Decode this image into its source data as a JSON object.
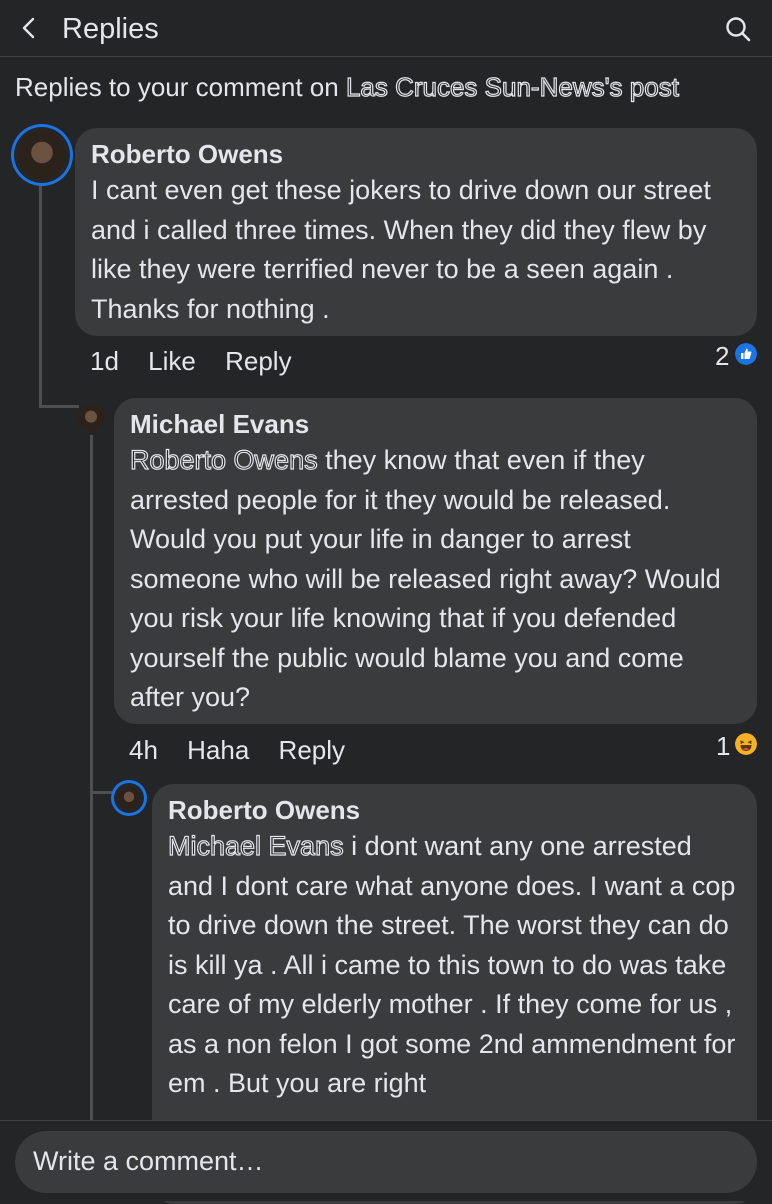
{
  "header": {
    "title": "Replies",
    "back_icon": "chevron-left-icon",
    "search_icon": "search-icon"
  },
  "context": {
    "prefix": "Replies to your comment on ",
    "page_name": "Las Cruces Sun-News",
    "suffix": "'s post"
  },
  "comments": [
    {
      "author": "Roberto Owens",
      "text": "I cant even get these jokers to drive down our street and i called three times. When they did they flew by like they were terrified never to be a seen again . Thanks for nothing .",
      "time": "1d",
      "actions": [
        "Like",
        "Reply"
      ],
      "reaction_count": "2",
      "reaction": "like-icon"
    },
    {
      "author": "Michael Evans",
      "mention": "Roberto Owens",
      "text": " they know that even if they arrested people for it they would be released.  Would you put your life in danger to arrest someone who will be released right away?  Would you risk your life knowing that if you defended yourself the public would blame you and come after you?",
      "time": "4h",
      "actions": [
        "Haha",
        "Reply"
      ],
      "reaction_count": "1",
      "reaction": "haha-icon"
    },
    {
      "author": "Roberto Owens",
      "mention": "Michael Evans",
      "text": " i dont want any one arrested and I dont care what anyone does. I want a cop to drive down the street.  The worst they can do is kill ya . All i came to this town to do was take care of my elderly mother . If they come for us , as a non felon I got some 2nd ammendment for em . But you are right"
    }
  ],
  "composer": {
    "placeholder": "Write a comment…"
  },
  "colors": {
    "background": "#242526",
    "bubble": "#3a3b3c",
    "accent": "#1b74e4",
    "haha": "#f7b125"
  }
}
